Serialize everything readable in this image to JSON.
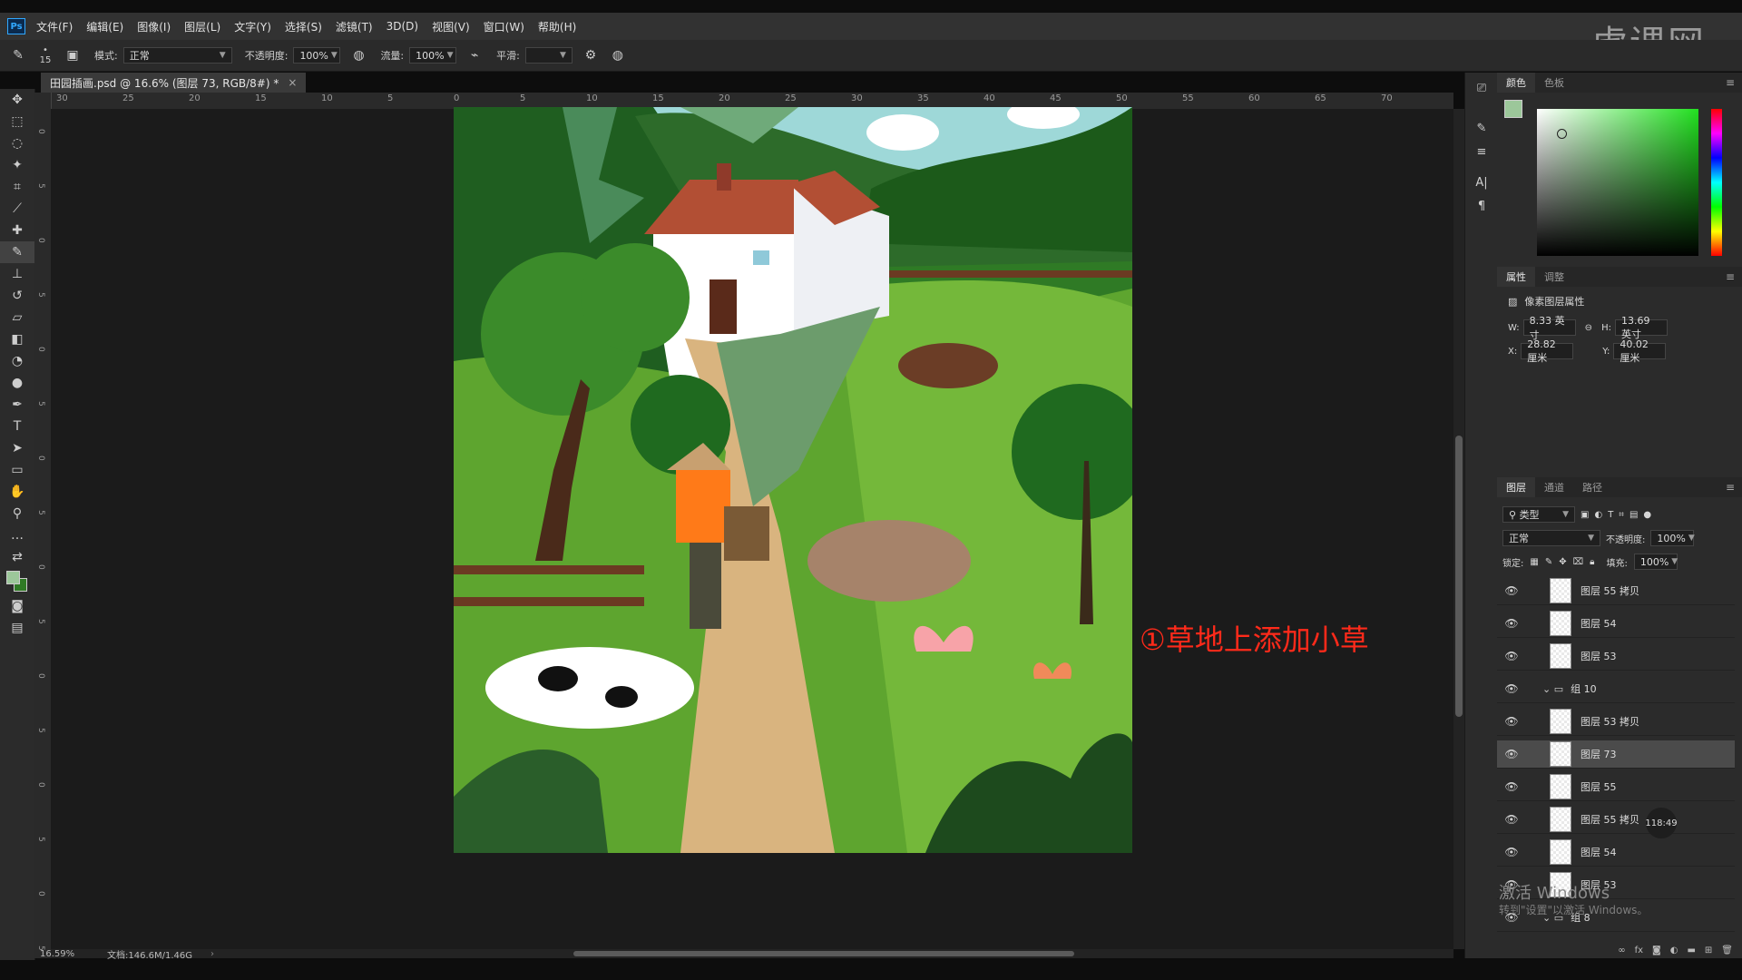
{
  "menu": {
    "logo": "Ps",
    "items": [
      "文件(F)",
      "编辑(E)",
      "图像(I)",
      "图层(L)",
      "文字(Y)",
      "选择(S)",
      "滤镜(T)",
      "3D(D)",
      "视图(V)",
      "窗口(W)",
      "帮助(H)"
    ],
    "brand": "虎课网"
  },
  "options": {
    "brush_size": "15",
    "mode_label": "模式:",
    "mode_value": "正常",
    "opacity_label": "不透明度:",
    "opacity_value": "100%",
    "flow_label": "流量:",
    "flow_value": "100%",
    "smooth_label": "平滑:",
    "smooth_value": ""
  },
  "document": {
    "tab_title": "田园插画.psd @ 16.6% (图层 73, RGB/8#) *",
    "zoom": "16.59%",
    "doc_size": "文档:146.6M/1.46G"
  },
  "rulers": {
    "h_ticks": [
      "30",
      "25",
      "20",
      "15",
      "10",
      "5",
      "0",
      "5",
      "10",
      "15",
      "20",
      "25",
      "30",
      "35",
      "40",
      "45",
      "50",
      "55",
      "60",
      "65",
      "70"
    ],
    "v_ticks": [
      "0",
      "5",
      "0",
      "5",
      "0",
      "5",
      "0",
      "5",
      "0",
      "5",
      "0",
      "5",
      "0",
      "5",
      "0",
      "5"
    ]
  },
  "annotation": "①草地上添加小草",
  "panels": {
    "color_tabs": [
      "颜色",
      "色板"
    ],
    "props_tabs": [
      "属性",
      "调整"
    ],
    "props_title": "像素图层属性",
    "w_label": "W:",
    "w_value": "8.33 英寸",
    "h_label": "H:",
    "h_value": "13.69 英寸",
    "x_label": "X:",
    "x_value": "28.82 厘米",
    "y_label": "Y:",
    "y_value": "40.02 厘米",
    "layers_tabs": [
      "图层",
      "通道",
      "路径"
    ],
    "filter_value": "类型",
    "blend_value": "正常",
    "opacity_label": "不透明度:",
    "opacity_value": "100%",
    "lock_label": "锁定:",
    "fill_label": "填充:",
    "fill_value": "100%",
    "layers": [
      {
        "name": "图层 55 拷贝",
        "type": "layer",
        "selected": false
      },
      {
        "name": "图层 54",
        "type": "layer",
        "selected": false
      },
      {
        "name": "图层 53",
        "type": "layer",
        "selected": false
      },
      {
        "name": "组 10",
        "type": "group",
        "selected": false
      },
      {
        "name": "图层 53 拷贝",
        "type": "layer",
        "selected": false
      },
      {
        "name": "图层 73",
        "type": "layer",
        "selected": true
      },
      {
        "name": "图层 55",
        "type": "layer",
        "selected": false
      },
      {
        "name": "图层 55 拷贝",
        "type": "layer",
        "selected": false
      },
      {
        "name": "图层 54",
        "type": "layer",
        "selected": false
      },
      {
        "name": "图层 53",
        "type": "layer",
        "selected": false
      },
      {
        "name": "组 8",
        "type": "group",
        "selected": false
      }
    ],
    "timer": "118:49"
  },
  "watermark": {
    "line1": "激活 Windows",
    "line2": "转到\"设置\"以激活 Windows。"
  },
  "colors": {
    "foreground": "#9cc79a",
    "background": "#2f7a25",
    "accent": "#31a8ff",
    "annotation": "#ff2a1a"
  }
}
